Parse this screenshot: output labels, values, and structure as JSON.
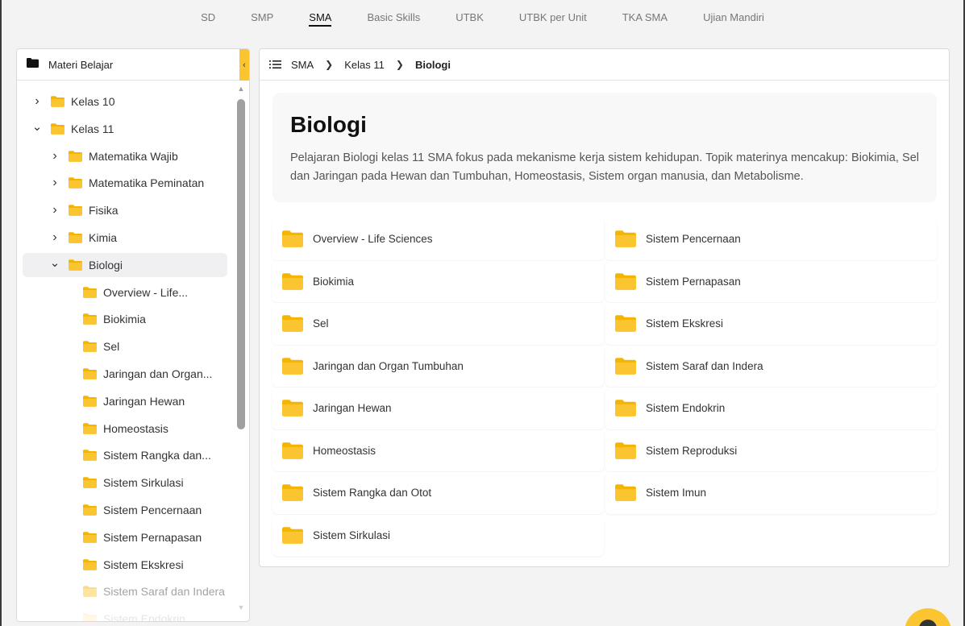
{
  "topnav": {
    "tabs": [
      {
        "label": "SD",
        "active": false
      },
      {
        "label": "SMP",
        "active": false
      },
      {
        "label": "SMA",
        "active": true
      },
      {
        "label": "Basic Skills",
        "active": false
      },
      {
        "label": "UTBK",
        "active": false
      },
      {
        "label": "UTBK per Unit",
        "active": false
      },
      {
        "label": "TKA SMA",
        "active": false
      },
      {
        "label": "Ujian Mandiri",
        "active": false
      }
    ]
  },
  "sidebar": {
    "title": "Materi Belajar",
    "collapse_icon": "chevron-left-icon",
    "tree": [
      {
        "label": "Kelas 10",
        "depth": 0,
        "expand": "collapsed"
      },
      {
        "label": "Kelas 11",
        "depth": 0,
        "expand": "expanded"
      },
      {
        "label": "Matematika Wajib",
        "depth": 1,
        "expand": "collapsed"
      },
      {
        "label": "Matematika Peminatan",
        "depth": 1,
        "expand": "collapsed"
      },
      {
        "label": "Fisika",
        "depth": 1,
        "expand": "collapsed"
      },
      {
        "label": "Kimia",
        "depth": 1,
        "expand": "collapsed"
      },
      {
        "label": "Biologi",
        "depth": 1,
        "expand": "expanded",
        "selected": true
      },
      {
        "label": "Overview - Life...",
        "depth": 2,
        "expand": "none"
      },
      {
        "label": "Biokimia",
        "depth": 2,
        "expand": "none"
      },
      {
        "label": "Sel",
        "depth": 2,
        "expand": "none"
      },
      {
        "label": "Jaringan dan Organ...",
        "depth": 2,
        "expand": "none"
      },
      {
        "label": "Jaringan Hewan",
        "depth": 2,
        "expand": "none"
      },
      {
        "label": "Homeostasis",
        "depth": 2,
        "expand": "none"
      },
      {
        "label": "Sistem Rangka dan...",
        "depth": 2,
        "expand": "none"
      },
      {
        "label": "Sistem Sirkulasi",
        "depth": 2,
        "expand": "none"
      },
      {
        "label": "Sistem Pencernaan",
        "depth": 2,
        "expand": "none"
      },
      {
        "label": "Sistem Pernapasan",
        "depth": 2,
        "expand": "none"
      },
      {
        "label": "Sistem Ekskresi",
        "depth": 2,
        "expand": "none"
      },
      {
        "label": "Sistem Saraf dan Indera",
        "depth": 2,
        "expand": "none",
        "fade": "light"
      },
      {
        "label": "Sistem Endokrin",
        "depth": 2,
        "expand": "none",
        "fade": "heavy"
      }
    ]
  },
  "breadcrumb": {
    "items": [
      "SMA",
      "Kelas 11"
    ],
    "current": "Biologi"
  },
  "hero": {
    "title": "Biologi",
    "description": "Pelajaran Biologi kelas 11 SMA fokus pada mekanisme kerja sistem kehidupan. Topik materinya mencakup: Biokimia, Sel dan Jaringan pada Hewan dan Tumbuhan, Homeostasis, Sistem organ manusia, dan Metabolisme."
  },
  "topics": [
    "Overview - Life Sciences",
    "Sistem Pencernaan",
    "Biokimia",
    "Sistem Pernapasan",
    "Sel",
    "Sistem Ekskresi",
    "Jaringan dan Organ Tumbuhan",
    "Sistem Saraf dan Indera",
    "Jaringan Hewan",
    "Sistem Endokrin",
    "Homeostasis",
    "Sistem Reproduksi",
    "Sistem Rangka dan Otot",
    "Sistem Imun",
    "Sistem Sirkulasi"
  ],
  "colors": {
    "accent": "#fbc531",
    "folder": "#fbc531",
    "folder_dark": "#f5b400"
  }
}
